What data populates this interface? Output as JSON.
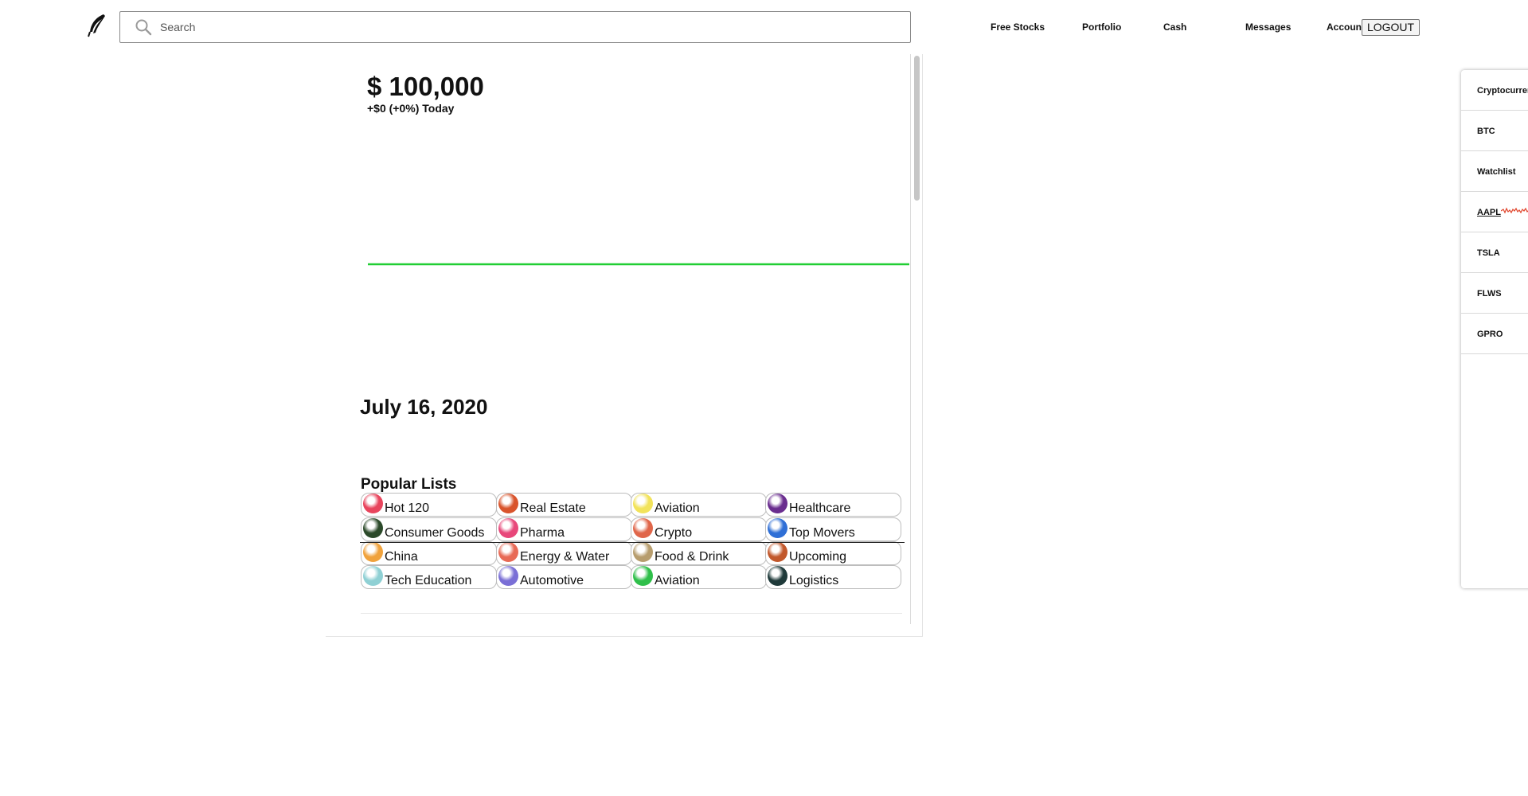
{
  "header": {
    "search_placeholder": "Search",
    "nav": [
      "Free Stocks",
      "Portfolio",
      "Cash",
      "Messages",
      "Account"
    ],
    "logout_label": "LOGOUT"
  },
  "portfolio": {
    "value": "$ 100,000",
    "change": "+$0 (+0%) Today",
    "line_color": "#21ce33"
  },
  "date": "July 16, 2020",
  "popular_lists": {
    "title": "Popular Lists",
    "items": [
      {
        "label": "Hot 120",
        "color": "#e8455d"
      },
      {
        "label": "Real Estate",
        "color": "#d9542c"
      },
      {
        "label": "Aviation",
        "color": "#f2e35b"
      },
      {
        "label": "Healthcare",
        "color": "#6a2d8f"
      },
      {
        "label": "Consumer Goods",
        "color": "#2c4a2a"
      },
      {
        "label": "Pharma",
        "color": "#e8477a"
      },
      {
        "label": "Crypto",
        "color": "#e0664a"
      },
      {
        "label": "Top Movers",
        "color": "#2f6fd6"
      },
      {
        "label": "China",
        "color": "#f0a23c"
      },
      {
        "label": "Energy & Water",
        "color": "#e86a56"
      },
      {
        "label": "Food & Drink",
        "color": "#b79d6e"
      },
      {
        "label": "Upcoming",
        "color": "#c2582c"
      },
      {
        "label": "Tech Education",
        "color": "#8fd0d4"
      },
      {
        "label": "Automotive",
        "color": "#7a6fd6"
      },
      {
        "label": "Aviation",
        "color": "#2fbf4a"
      },
      {
        "label": "Logistics",
        "color": "#1f3a3a"
      }
    ]
  },
  "sidebar": {
    "section_crypto": "Cryptocurrencies",
    "crypto_items": [
      "BTC"
    ],
    "section_watchlist": "Watchlist",
    "watchlist_items": [
      "AAPL",
      "TSLA",
      "FLWS",
      "GPRO"
    ],
    "sparkline_color": "#e0452c"
  }
}
